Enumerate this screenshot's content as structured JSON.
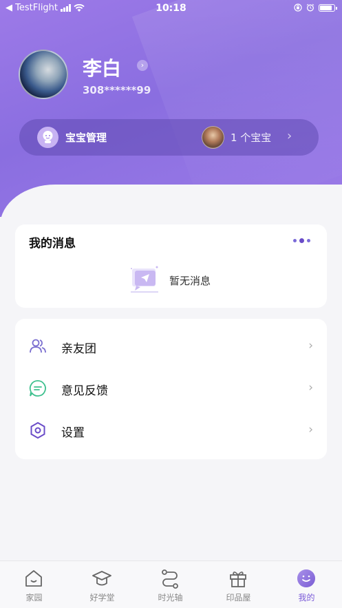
{
  "status_bar": {
    "carrier": "◀ TestFlight",
    "time": "10:18"
  },
  "profile": {
    "name": "李白",
    "phone": "308******99"
  },
  "baby_bar": {
    "label": "宝宝管理",
    "count": "1 个宝宝",
    "chevron": "›"
  },
  "messages": {
    "title": "我的消息",
    "empty_text": "暂无消息"
  },
  "menu": {
    "items": [
      {
        "label": "亲友团",
        "icon": "friends-icon",
        "chevron": "›"
      },
      {
        "label": "意见反馈",
        "icon": "feedback-icon",
        "chevron": "›"
      },
      {
        "label": "设置",
        "icon": "settings-icon",
        "chevron": "›"
      }
    ]
  },
  "tabbar": {
    "tabs": [
      {
        "label": "家园",
        "icon": "home-icon"
      },
      {
        "label": "好学堂",
        "icon": "graduation-cap-icon"
      },
      {
        "label": "时光轴",
        "icon": "timeline-icon"
      },
      {
        "label": "印品屋",
        "icon": "gift-icon"
      },
      {
        "label": "我的",
        "icon": "profile-icon"
      }
    ],
    "active_index": 4
  },
  "colors": {
    "accent": "#8a6ee0",
    "active_tab": "#7a5ad8"
  }
}
